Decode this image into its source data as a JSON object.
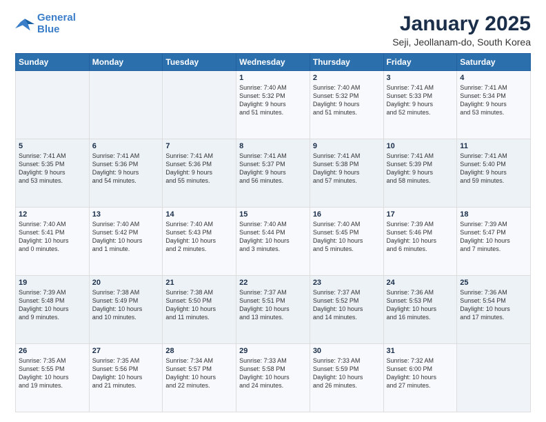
{
  "logo": {
    "line1": "General",
    "line2": "Blue"
  },
  "title": "January 2025",
  "subtitle": "Seji, Jeollanam-do, South Korea",
  "days_of_week": [
    "Sunday",
    "Monday",
    "Tuesday",
    "Wednesday",
    "Thursday",
    "Friday",
    "Saturday"
  ],
  "weeks": [
    [
      {
        "day": "",
        "info": ""
      },
      {
        "day": "",
        "info": ""
      },
      {
        "day": "",
        "info": ""
      },
      {
        "day": "1",
        "info": "Sunrise: 7:40 AM\nSunset: 5:32 PM\nDaylight: 9 hours\nand 51 minutes."
      },
      {
        "day": "2",
        "info": "Sunrise: 7:40 AM\nSunset: 5:32 PM\nDaylight: 9 hours\nand 51 minutes."
      },
      {
        "day": "3",
        "info": "Sunrise: 7:41 AM\nSunset: 5:33 PM\nDaylight: 9 hours\nand 52 minutes."
      },
      {
        "day": "4",
        "info": "Sunrise: 7:41 AM\nSunset: 5:34 PM\nDaylight: 9 hours\nand 53 minutes."
      }
    ],
    [
      {
        "day": "5",
        "info": "Sunrise: 7:41 AM\nSunset: 5:35 PM\nDaylight: 9 hours\nand 53 minutes."
      },
      {
        "day": "6",
        "info": "Sunrise: 7:41 AM\nSunset: 5:36 PM\nDaylight: 9 hours\nand 54 minutes."
      },
      {
        "day": "7",
        "info": "Sunrise: 7:41 AM\nSunset: 5:36 PM\nDaylight: 9 hours\nand 55 minutes."
      },
      {
        "day": "8",
        "info": "Sunrise: 7:41 AM\nSunset: 5:37 PM\nDaylight: 9 hours\nand 56 minutes."
      },
      {
        "day": "9",
        "info": "Sunrise: 7:41 AM\nSunset: 5:38 PM\nDaylight: 9 hours\nand 57 minutes."
      },
      {
        "day": "10",
        "info": "Sunrise: 7:41 AM\nSunset: 5:39 PM\nDaylight: 9 hours\nand 58 minutes."
      },
      {
        "day": "11",
        "info": "Sunrise: 7:41 AM\nSunset: 5:40 PM\nDaylight: 9 hours\nand 59 minutes."
      }
    ],
    [
      {
        "day": "12",
        "info": "Sunrise: 7:40 AM\nSunset: 5:41 PM\nDaylight: 10 hours\nand 0 minutes."
      },
      {
        "day": "13",
        "info": "Sunrise: 7:40 AM\nSunset: 5:42 PM\nDaylight: 10 hours\nand 1 minute."
      },
      {
        "day": "14",
        "info": "Sunrise: 7:40 AM\nSunset: 5:43 PM\nDaylight: 10 hours\nand 2 minutes."
      },
      {
        "day": "15",
        "info": "Sunrise: 7:40 AM\nSunset: 5:44 PM\nDaylight: 10 hours\nand 3 minutes."
      },
      {
        "day": "16",
        "info": "Sunrise: 7:40 AM\nSunset: 5:45 PM\nDaylight: 10 hours\nand 5 minutes."
      },
      {
        "day": "17",
        "info": "Sunrise: 7:39 AM\nSunset: 5:46 PM\nDaylight: 10 hours\nand 6 minutes."
      },
      {
        "day": "18",
        "info": "Sunrise: 7:39 AM\nSunset: 5:47 PM\nDaylight: 10 hours\nand 7 minutes."
      }
    ],
    [
      {
        "day": "19",
        "info": "Sunrise: 7:39 AM\nSunset: 5:48 PM\nDaylight: 10 hours\nand 9 minutes."
      },
      {
        "day": "20",
        "info": "Sunrise: 7:38 AM\nSunset: 5:49 PM\nDaylight: 10 hours\nand 10 minutes."
      },
      {
        "day": "21",
        "info": "Sunrise: 7:38 AM\nSunset: 5:50 PM\nDaylight: 10 hours\nand 11 minutes."
      },
      {
        "day": "22",
        "info": "Sunrise: 7:37 AM\nSunset: 5:51 PM\nDaylight: 10 hours\nand 13 minutes."
      },
      {
        "day": "23",
        "info": "Sunrise: 7:37 AM\nSunset: 5:52 PM\nDaylight: 10 hours\nand 14 minutes."
      },
      {
        "day": "24",
        "info": "Sunrise: 7:36 AM\nSunset: 5:53 PM\nDaylight: 10 hours\nand 16 minutes."
      },
      {
        "day": "25",
        "info": "Sunrise: 7:36 AM\nSunset: 5:54 PM\nDaylight: 10 hours\nand 17 minutes."
      }
    ],
    [
      {
        "day": "26",
        "info": "Sunrise: 7:35 AM\nSunset: 5:55 PM\nDaylight: 10 hours\nand 19 minutes."
      },
      {
        "day": "27",
        "info": "Sunrise: 7:35 AM\nSunset: 5:56 PM\nDaylight: 10 hours\nand 21 minutes."
      },
      {
        "day": "28",
        "info": "Sunrise: 7:34 AM\nSunset: 5:57 PM\nDaylight: 10 hours\nand 22 minutes."
      },
      {
        "day": "29",
        "info": "Sunrise: 7:33 AM\nSunset: 5:58 PM\nDaylight: 10 hours\nand 24 minutes."
      },
      {
        "day": "30",
        "info": "Sunrise: 7:33 AM\nSunset: 5:59 PM\nDaylight: 10 hours\nand 26 minutes."
      },
      {
        "day": "31",
        "info": "Sunrise: 7:32 AM\nSunset: 6:00 PM\nDaylight: 10 hours\nand 27 minutes."
      },
      {
        "day": "",
        "info": ""
      }
    ]
  ]
}
